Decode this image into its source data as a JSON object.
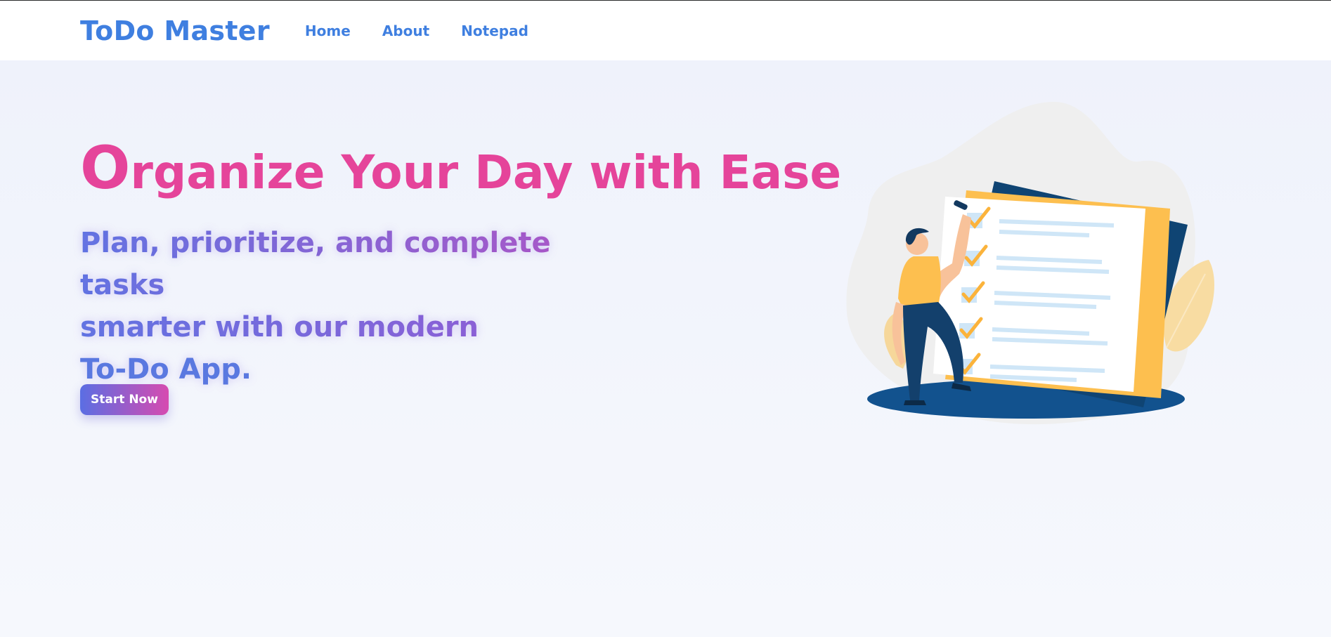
{
  "nav": {
    "brand": "ToDo Master",
    "links": [
      "Home",
      "About",
      "Notepad"
    ]
  },
  "hero": {
    "headline_first_letter": "O",
    "headline_rest": "rganize Your Day with Ease",
    "subtitle_lines": [
      "Plan, prioritize, and complete tasks",
      "smarter with our modern",
      "To-Do App."
    ],
    "cta_label": "Start Now"
  },
  "colors": {
    "brand_blue": "#3f7fe0",
    "headline_pink": "#e5449a",
    "gradient_start": "#5b6ee3",
    "gradient_end": "#d64bb0",
    "illustration_navy": "#0f4c81",
    "illustration_yellow": "#fdbf4f"
  },
  "illustration": {
    "icon": "checklist-person-illustration",
    "checked_items": 5
  }
}
